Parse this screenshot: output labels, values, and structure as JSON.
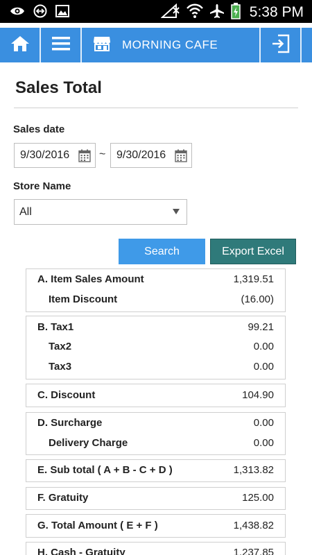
{
  "status_bar": {
    "time": "5:38 PM",
    "icons": [
      "eye-icon",
      "link-icon",
      "image-icon",
      "no-signal-icon",
      "wifi-icon",
      "airplane-icon",
      "battery-icon"
    ]
  },
  "app_bar": {
    "cafe_name": "MORNING CAFE",
    "icons": [
      "home-icon",
      "menu-icon",
      "store-icon",
      "logout-icon"
    ]
  },
  "page": {
    "title": "Sales Total"
  },
  "filters": {
    "sales_date_label": "Sales date",
    "date_from": "9/30/2016",
    "date_separator": "~",
    "date_to": "9/30/2016",
    "store_label": "Store Name",
    "store_value": "All"
  },
  "actions": {
    "search_label": "Search",
    "export_label": "Export Excel"
  },
  "summary": {
    "groups": [
      {
        "rows": [
          {
            "label": "A. Item Sales Amount",
            "value": "1,319.51"
          },
          {
            "label": "Item Discount",
            "value": "(16.00)"
          }
        ]
      },
      {
        "rows": [
          {
            "label": "B. Tax1",
            "value": "99.21"
          },
          {
            "label": "Tax2",
            "value": "0.00"
          },
          {
            "label": "Tax3",
            "value": "0.00"
          }
        ]
      },
      {
        "rows": [
          {
            "label": "C. Discount",
            "value": "104.90"
          }
        ]
      },
      {
        "rows": [
          {
            "label": "D. Surcharge",
            "value": "0.00"
          },
          {
            "label": "Delivery Charge",
            "value": "0.00"
          }
        ]
      },
      {
        "rows": [
          {
            "label": "E. Sub total ( A + B - C + D )",
            "value": "1,313.82"
          }
        ]
      },
      {
        "rows": [
          {
            "label": "F. Gratuity",
            "value": "125.00"
          }
        ]
      },
      {
        "rows": [
          {
            "label": "G. Total Amount ( E + F )",
            "value": "1,438.82"
          }
        ]
      },
      {
        "rows": [
          {
            "label": "H. Cash - Gratuity",
            "value": "1,237.85"
          }
        ]
      }
    ]
  },
  "colors": {
    "app_bar": "#3a8fe0",
    "search_button": "#3f9ae8",
    "export_button": "#2f7a7a"
  }
}
